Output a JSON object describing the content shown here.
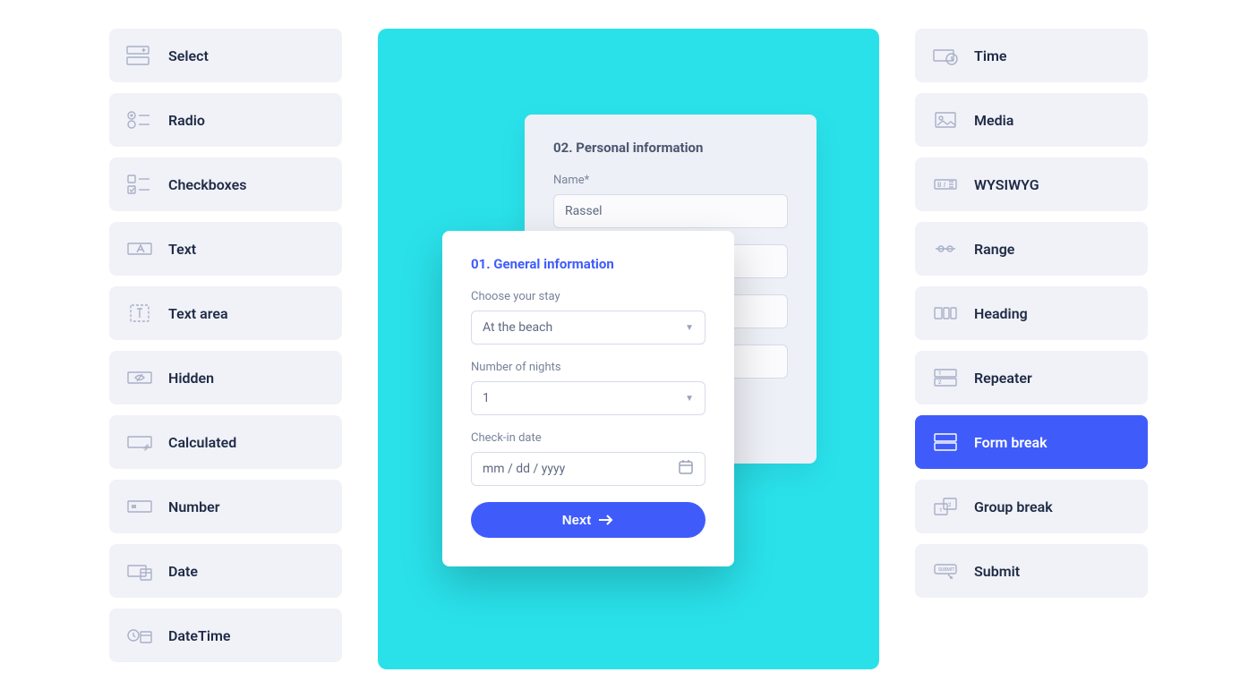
{
  "left_widgets": [
    {
      "key": "select",
      "label": "Select",
      "icon": "select-icon"
    },
    {
      "key": "radio",
      "label": "Radio",
      "icon": "radio-icon"
    },
    {
      "key": "checkboxes",
      "label": "Checkboxes",
      "icon": "checkboxes-icon"
    },
    {
      "key": "text",
      "label": "Text",
      "icon": "text-icon"
    },
    {
      "key": "textarea",
      "label": "Text area",
      "icon": "textarea-icon"
    },
    {
      "key": "hidden",
      "label": "Hidden",
      "icon": "hidden-icon"
    },
    {
      "key": "calculated",
      "label": "Calculated",
      "icon": "calculated-icon"
    },
    {
      "key": "number",
      "label": "Number",
      "icon": "number-icon"
    },
    {
      "key": "date",
      "label": "Date",
      "icon": "date-icon"
    },
    {
      "key": "datetime",
      "label": "DateTime",
      "icon": "datetime-icon"
    }
  ],
  "right_widgets": [
    {
      "key": "time",
      "label": "Time",
      "icon": "time-icon",
      "active": false
    },
    {
      "key": "media",
      "label": "Media",
      "icon": "media-icon",
      "active": false
    },
    {
      "key": "wysiwyg",
      "label": "WYSIWYG",
      "icon": "wysiwyg-icon",
      "active": false
    },
    {
      "key": "range",
      "label": "Range",
      "icon": "range-icon",
      "active": false
    },
    {
      "key": "heading",
      "label": "Heading",
      "icon": "heading-icon",
      "active": false
    },
    {
      "key": "repeater",
      "label": "Repeater",
      "icon": "repeater-icon",
      "active": false
    },
    {
      "key": "formbreak",
      "label": "Form break",
      "icon": "formbreak-icon",
      "active": true
    },
    {
      "key": "groupbreak",
      "label": "Group break",
      "icon": "groupbreak-icon",
      "active": false
    },
    {
      "key": "submit",
      "label": "Submit",
      "icon": "submit-icon",
      "active": false
    }
  ],
  "form": {
    "step2": {
      "title": "02. Personal information",
      "name_label": "Name*",
      "name_value": "Rassel"
    },
    "step1": {
      "title": "01. General information",
      "stay_label": "Choose your stay",
      "stay_value": "At the beach",
      "nights_label": "Number of nights",
      "nights_value": "1",
      "checkin_label": "Check-in date",
      "checkin_placeholder": "mm / dd / yyyy",
      "next_label": "Next"
    }
  },
  "colors": {
    "accent": "#3f5cfb",
    "canvas": "#2ae1ea",
    "widget_bg": "#f1f2f8"
  }
}
